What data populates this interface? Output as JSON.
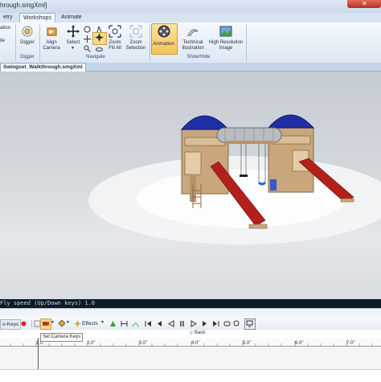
{
  "window": {
    "title": "hrough.smgXml]"
  },
  "ribbon_tabs": [
    {
      "label": "etry"
    },
    {
      "label": "Workshops"
    },
    {
      "label": "Animate"
    }
  ],
  "ribbon": {
    "left_partial": {
      "label1": "ation",
      "label2": "ile"
    },
    "digger_button": "Digger",
    "digger_group": "Digger",
    "align_camera_line1": "Align",
    "align_camera_line2": "Camera",
    "select_line1": "Select",
    "zoom_fill_line1": "Zoom",
    "zoom_fill_line2": "Fill All",
    "zoom_selection_line1": "Zoom",
    "zoom_selection_line2": "Selection",
    "navigate_group": "Navigate",
    "animation_button": "Animation",
    "technical_line1": "Technical",
    "technical_line2": "Illustration",
    "hires_line1": "High Resolution",
    "hires_line2": "Image",
    "showhide_group": "Show/Hide"
  },
  "document_tab": "Swingset_Walkthrough.smgXml",
  "viewport": {
    "status_text": "Fly speed (Up/Down keys) 1.0"
  },
  "animation_toolbar": {
    "autokeys_label": "o-Keys",
    "effects_label": "Effects",
    "tooltip": "Set Camera Keys",
    "back_label": "Back"
  },
  "timeline": {
    "ticks": [
      "1.0\"",
      "2.0\"",
      "3.0\"",
      "4.0\"",
      "5.0\"",
      "6.0\"",
      "7.0\""
    ]
  },
  "colors": {
    "roof": "#1f2fa6",
    "slide": "#b3201c",
    "wood": "#c9a67c",
    "ribbon_active": "#f6c760"
  }
}
